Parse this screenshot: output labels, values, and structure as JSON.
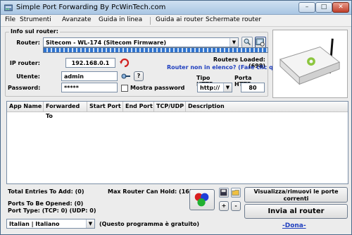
{
  "window": {
    "title": "Simple Port Forwarding By PcWinTech.com"
  },
  "titlebar_buttons": {
    "minimize": "–",
    "maximize": "□",
    "close": "✕"
  },
  "menu": {
    "items": [
      "File",
      "Strumenti",
      "Avanzate",
      "Guida in linea",
      "Guida ai router",
      "Schermate router"
    ]
  },
  "info": {
    "legend": "Info sul router:",
    "router_label": "Router:",
    "router_value": "Sitecom - WL-174 (Sitecom Firmware)",
    "routers_loaded": "Routers Loaded: (698)",
    "router_missing_link": "Router non in elenco? (Fare clic qui)",
    "ip_label": "IP router:",
    "ip_value": "192.168.0.1",
    "user_label": "Utente:",
    "user_value": "admin",
    "password_label": "Password:",
    "password_value": "*****",
    "show_password_label": "Mostra password",
    "http_type_label": "Tipo HTTP:",
    "http_type_value": "http://",
    "http_port_label": "Porta HTTP:",
    "http_port_value": "80",
    "help_button": "?"
  },
  "table": {
    "headers": [
      "App Name",
      "Forwarded To",
      "Start Port",
      "End Port",
      "TCP/UDP",
      "Description"
    ],
    "rows": []
  },
  "status": {
    "total_entries": "Total Entries To Add: (0)",
    "max_router": "Max Router Can Hold: (16)",
    "ports_opened": "Ports To Be Opened: (0)",
    "port_type": "Port Type: (TCP: 0) (UDP: 0)"
  },
  "controls": {
    "plus": "+",
    "minus": "-",
    "view_remove_button": "Visualizza/rimuovi le porte correnti",
    "send_button": "Invia al router",
    "donate_link": "-Dona-",
    "language_value": "Italian | Italiano",
    "free_program_note": "(Questo programma è gratuito)"
  },
  "colors": {
    "accent_link": "#1f3fbf",
    "progress_fill": "#2f74d0",
    "window_bg": "#ececec"
  }
}
